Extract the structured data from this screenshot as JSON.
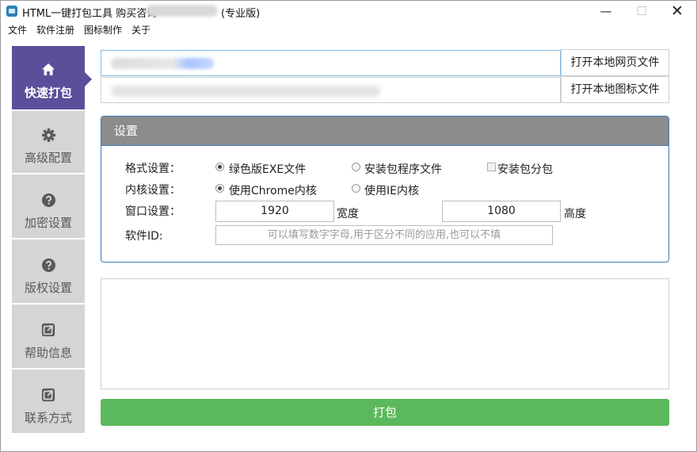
{
  "window": {
    "title": "HTML一键打包工具 购买咨询",
    "edition": "(专业版)",
    "controls": {
      "minimize": "—",
      "maximize": "☐",
      "close": "✕"
    }
  },
  "menu": [
    "文件",
    "软件注册",
    "图标制作",
    "关于"
  ],
  "sidebar": {
    "items": [
      {
        "label": "快速打包",
        "icon": "home-icon",
        "active": true
      },
      {
        "label": "高级配置",
        "icon": "gear-icon",
        "active": false
      },
      {
        "label": "加密设置",
        "icon": "question-icon",
        "active": false
      },
      {
        "label": "版权设置",
        "icon": "question-icon",
        "active": false
      },
      {
        "label": "帮助信息",
        "icon": "share-icon",
        "active": false
      },
      {
        "label": "联系方式",
        "icon": "share-icon",
        "active": false
      }
    ]
  },
  "inputs": {
    "open_web_file_label": "打开本地网页文件",
    "open_icon_file_label": "打开本地图标文件"
  },
  "settings": {
    "title": "设置",
    "format_label": "格式设置：",
    "format_options": [
      {
        "label": "绿色版EXE文件",
        "checked": true
      },
      {
        "label": "安装包程序文件",
        "checked": false
      }
    ],
    "split_label": "安装包分包",
    "split_checked": false,
    "kernel_label": "内核设置：",
    "kernel_options": [
      {
        "label": "使用Chrome内核",
        "checked": true
      },
      {
        "label": "使用IE内核",
        "checked": false
      }
    ],
    "window_label": "窗口设置：",
    "width_value": "1920",
    "width_unit": "宽度",
    "height_value": "1080",
    "height_unit": "高度",
    "id_label": "软件ID:",
    "id_placeholder": "可以填写数字字母,用于区分不同的应用,也可以不填"
  },
  "pack_button": "打包",
  "colors": {
    "sidebar_active": "#5c4e9a",
    "sidebar_bg": "#d5d5d5",
    "panel_header": "#8c8c8c",
    "panel_border": "#3e7ab5",
    "pack_button": "#5cb85c"
  }
}
